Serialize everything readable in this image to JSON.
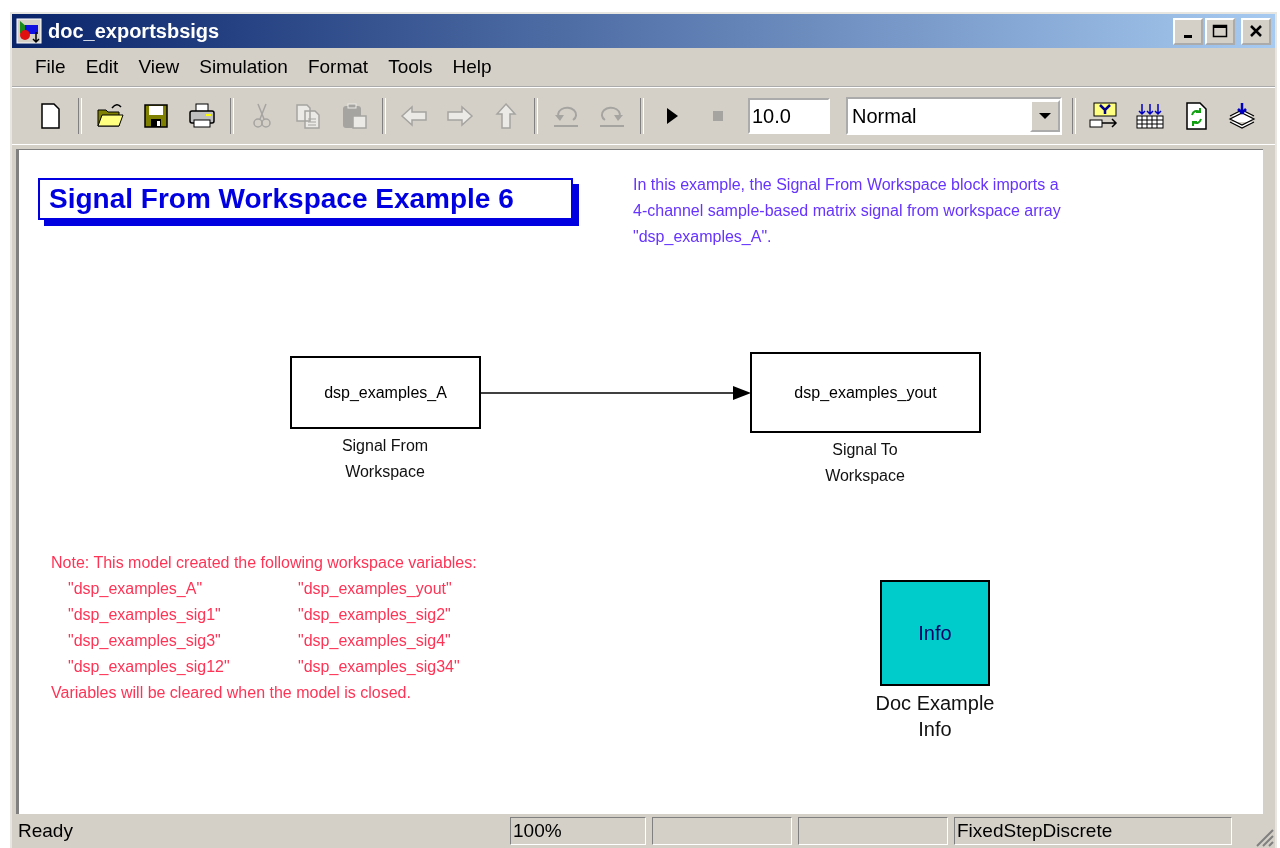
{
  "window": {
    "title": "doc_exportsbsigs"
  },
  "menu": [
    "File",
    "Edit",
    "View",
    "Simulation",
    "Format",
    "Tools",
    "Help"
  ],
  "toolbar": [
    {
      "kind": "new",
      "disabled": false
    },
    {
      "kind": "separator"
    },
    {
      "kind": "open",
      "disabled": false
    },
    {
      "kind": "save",
      "disabled": false
    },
    {
      "kind": "print",
      "disabled": false
    },
    {
      "kind": "separator"
    },
    {
      "kind": "cut",
      "disabled": true
    },
    {
      "kind": "copy",
      "disabled": true
    },
    {
      "kind": "paste",
      "disabled": true
    },
    {
      "kind": "separator"
    },
    {
      "kind": "back",
      "disabled": true
    },
    {
      "kind": "forward",
      "disabled": true
    },
    {
      "kind": "up",
      "disabled": true
    },
    {
      "kind": "separator"
    },
    {
      "kind": "undo",
      "disabled": true
    },
    {
      "kind": "redo",
      "disabled": true
    },
    {
      "kind": "separator"
    },
    {
      "kind": "run",
      "disabled": false
    },
    {
      "kind": "stop",
      "disabled": true
    }
  ],
  "stop_time": "10.0",
  "sim_mode": "Normal",
  "toolbar_right": [
    {
      "kind": "yplot"
    },
    {
      "kind": "grid"
    },
    {
      "kind": "refresh"
    },
    {
      "kind": "stack"
    }
  ],
  "title_annotation": "Signal From Workspace Example 6",
  "description": "In this example, the Signal From Workspace block imports a\n4-channel sample-based matrix signal from workspace array\n\"dsp_examples_A\".",
  "blocks": [
    {
      "kind": "source",
      "text": "dsp_examples_A",
      "label": "Signal From\nWorkspace"
    },
    {
      "kind": "sink",
      "text": "dsp_examples_yout",
      "label": "Signal To\nWorkspace"
    },
    {
      "kind": "info",
      "text": "Info",
      "label": "Doc Example\nInfo"
    }
  ],
  "note": {
    "heading": "Note: This model created the following workspace variables:",
    "variables": [
      [
        "\"dsp_examples_A\"",
        "\"dsp_examples_yout\""
      ],
      [
        "\"dsp_examples_sig1\"",
        "\"dsp_examples_sig2\""
      ],
      [
        "\"dsp_examples_sig3\"",
        "\"dsp_examples_sig4\""
      ],
      [
        "\"dsp_examples_sig12\"",
        "\"dsp_examples_sig34\""
      ]
    ],
    "footer": "Variables will be cleared when the model is closed."
  },
  "status_bar": {
    "message": "Ready",
    "zoom": "100%",
    "solver": "FixedStepDiscrete"
  }
}
